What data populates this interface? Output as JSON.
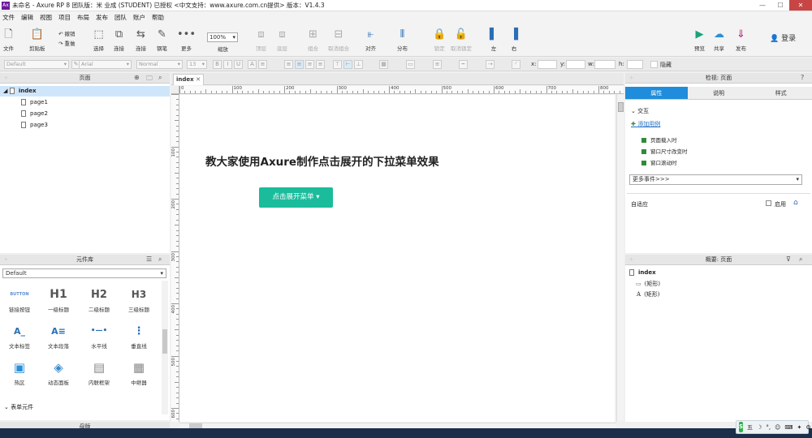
{
  "window": {
    "title": "未命名 - Axure RP 8 团队版：米 业成 (STUDENT) 已授权  <中文支持：www.axure.com.cn提供> 版本：V1.4.3",
    "minimize": "—",
    "maximize": "☐",
    "close": "✕"
  },
  "menu": [
    "文件",
    "编辑",
    "视图",
    "项目",
    "布局",
    "发布",
    "团队",
    "账户",
    "帮助"
  ],
  "toolbar": {
    "file": "文件",
    "clipboard": "剪贴板",
    "undo": "撤销",
    "redo": "重做",
    "select": "选择",
    "connect": "连接",
    "pen": "钢笔",
    "more": "更多",
    "zoom": "100%",
    "zoom_label": "缩放",
    "top": "顶层",
    "bottom": "底层",
    "group": "组合",
    "ungroup": "取消组合",
    "align": "对齐",
    "distribute": "分布",
    "lock": "锁定",
    "unlock": "取消锁定",
    "left": "左",
    "right": "右",
    "preview": "预览",
    "share": "共享",
    "publish": "发布",
    "login": "登录"
  },
  "format": {
    "style": "Default",
    "font": "Arial",
    "weight": "Normal",
    "size": "13",
    "x": "x:",
    "y": "y:",
    "w": "w:",
    "h": "h:",
    "hidden": "隐藏"
  },
  "pages": {
    "title": "页面",
    "root": "index",
    "items": [
      "page1",
      "page2",
      "page3"
    ]
  },
  "library": {
    "title": "元件库",
    "selected": "Default",
    "widgets": [
      {
        "icon": "BUTTON",
        "label": "链接按钮"
      },
      {
        "icon": "H1",
        "label": "一级标题"
      },
      {
        "icon": "H2",
        "label": "二级标题"
      },
      {
        "icon": "H3",
        "label": "三级标题"
      },
      {
        "icon": "A_",
        "label": "文本标签"
      },
      {
        "icon": "A≡",
        "label": "文本段落"
      },
      {
        "icon": "•—•",
        "label": "水平线"
      },
      {
        "icon": "⋮",
        "label": "垂直线"
      },
      {
        "icon": "▣",
        "label": "热区"
      },
      {
        "icon": "◈",
        "label": "动态面板"
      },
      {
        "icon": "▤",
        "label": "内联框架"
      },
      {
        "icon": "▦",
        "label": "中继器"
      }
    ],
    "section": "表单元件"
  },
  "masters": {
    "title": "母版"
  },
  "canvas": {
    "tab": "index",
    "heading": "教大家使用Axure制作点击展开的下拉菜单效果",
    "button": "点击展开菜单 ▾",
    "hticks": [
      "0",
      "100",
      "200",
      "300",
      "400",
      "500",
      "600",
      "700",
      "800"
    ],
    "vticks": [
      "100",
      "200",
      "300",
      "400",
      "500",
      "600"
    ]
  },
  "inspector": {
    "title": "检视: 页面",
    "tabs": [
      "属性",
      "说明",
      "样式"
    ],
    "interaction": "交互",
    "add_case": "添加用例",
    "events": [
      "页面载入时",
      "窗口尺寸改变时",
      "窗口滚动时"
    ],
    "more_events": "更多事件>>>",
    "adaptive": "自适应",
    "enable": "启用"
  },
  "outline": {
    "title": "概要: 页面",
    "root": "index",
    "items": [
      {
        "icon": "▭",
        "label": "(矩形)"
      },
      {
        "icon": "A",
        "label": "(矩形)"
      }
    ]
  },
  "tray": [
    "五",
    "☽",
    "°,",
    "☺",
    "⌨",
    "✦",
    "⚙"
  ]
}
